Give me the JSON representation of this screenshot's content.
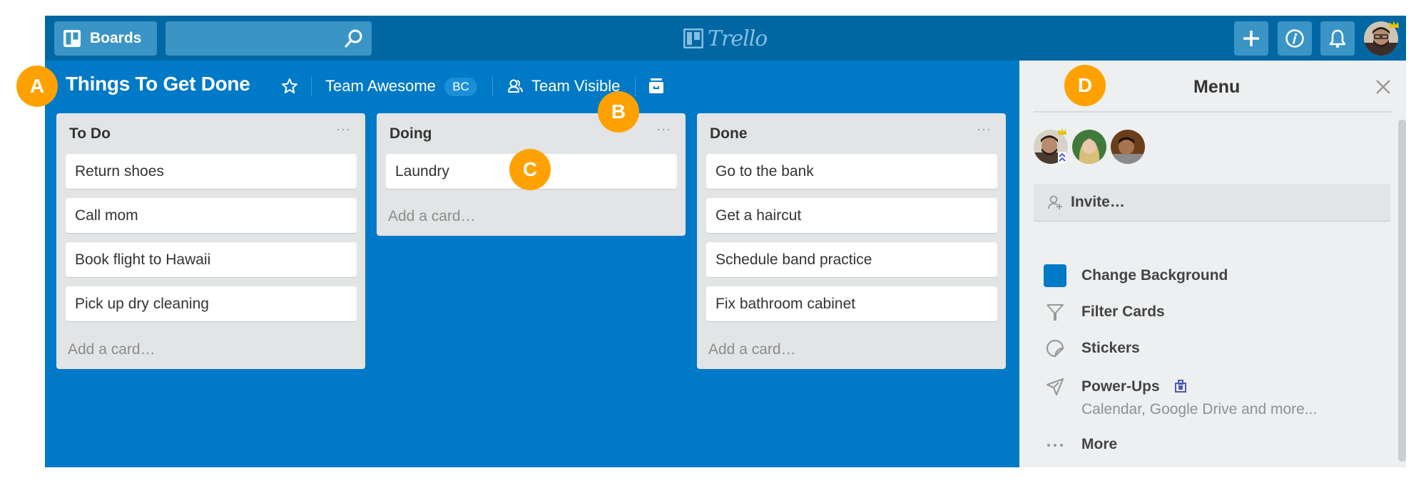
{
  "header": {
    "boards_label": "Boards",
    "search_value": "",
    "search_placeholder": "",
    "logo_text": "Trello",
    "icons": [
      "plus-icon",
      "info-icon",
      "bell-icon"
    ]
  },
  "board": {
    "title": "Things To Get Done",
    "team_name": "Team Awesome",
    "team_badge": "BC",
    "visibility": "Team Visible"
  },
  "markers": [
    "A",
    "B",
    "C",
    "D"
  ],
  "lists": [
    {
      "title": "To Do",
      "menu": "···",
      "cards": [
        "Return shoes",
        "Call mom",
        "Book flight to Hawaii",
        "Pick up dry cleaning"
      ],
      "add_label": "Add a card…"
    },
    {
      "title": "Doing",
      "menu": "···",
      "cards": [
        "Laundry"
      ],
      "add_label": "Add a card…"
    },
    {
      "title": "Done",
      "menu": "···",
      "cards": [
        "Go to the bank",
        "Get a haircut",
        "Schedule band practice",
        "Fix bathroom cabinet"
      ],
      "add_label": "Add a card…"
    }
  ],
  "menu": {
    "title": "Menu",
    "invite_label": "Invite…",
    "items": [
      {
        "label": "Change Background",
        "icon": "color-swatch-icon"
      },
      {
        "label": "Filter Cards",
        "icon": "filter-icon"
      },
      {
        "label": "Stickers",
        "icon": "sticker-icon"
      },
      {
        "label": "Power-Ups",
        "icon": "rocket-icon",
        "subtitle": "Calendar, Google Drive and more..."
      },
      {
        "label": "More",
        "icon": "more-icon"
      }
    ]
  },
  "colors": {
    "board_background": "#0079c6",
    "header": "#0067a3",
    "marker": "#ffa100"
  }
}
